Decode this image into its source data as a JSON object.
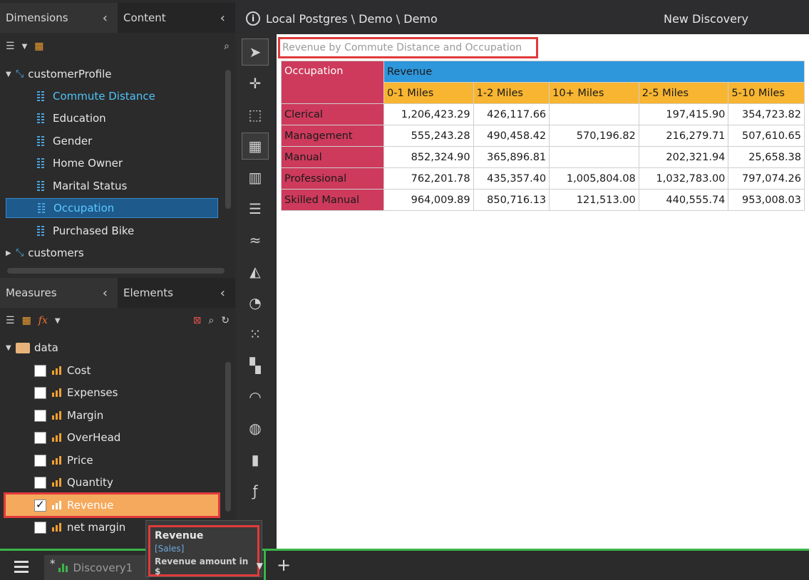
{
  "dimensions_panel": {
    "tab_dimensions": "Dimensions",
    "tab_content": "Content",
    "tree": [
      {
        "label": "customerProfile",
        "type": "hierarchy"
      },
      {
        "label": "Commute Distance",
        "type": "attribute",
        "state": "used"
      },
      {
        "label": "Education",
        "type": "attribute"
      },
      {
        "label": "Gender",
        "type": "attribute"
      },
      {
        "label": "Home Owner",
        "type": "attribute"
      },
      {
        "label": "Marital Status",
        "type": "attribute"
      },
      {
        "label": "Occupation",
        "type": "attribute",
        "state": "selected"
      },
      {
        "label": "Purchased Bike",
        "type": "attribute"
      },
      {
        "label": "customers",
        "type": "hierarchy"
      }
    ]
  },
  "measures_panel": {
    "tab_measures": "Measures",
    "tab_elements": "Elements",
    "folder": "data",
    "items": [
      {
        "label": "Cost",
        "checked": false
      },
      {
        "label": "Expenses",
        "checked": false
      },
      {
        "label": "Margin",
        "checked": false
      },
      {
        "label": "OverHead",
        "checked": false
      },
      {
        "label": "Price",
        "checked": false
      },
      {
        "label": "Quantity",
        "checked": false
      },
      {
        "label": "Revenue",
        "checked": true
      },
      {
        "label": "net margin",
        "checked": false
      }
    ]
  },
  "header": {
    "breadcrumb": "Local Postgres \\ Demo \\ Demo",
    "discovery": "New Discovery"
  },
  "visual": {
    "title": "Revenue by Commute Distance and Occupation",
    "row_header": "Occupation",
    "measure_header": "Revenue",
    "columns": [
      "0-1 Miles",
      "1-2 Miles",
      "10+ Miles",
      "2-5 Miles",
      "5-10 Miles"
    ],
    "rows": [
      {
        "label": "Clerical",
        "values": [
          "1,206,423.29",
          "426,117.66",
          "",
          "197,415.90",
          "354,723.82"
        ]
      },
      {
        "label": "Management",
        "values": [
          "555,243.28",
          "490,458.42",
          "570,196.82",
          "216,279.71",
          "507,610.65"
        ]
      },
      {
        "label": "Manual",
        "values": [
          "852,324.90",
          "365,896.81",
          "",
          "202,321.94",
          "25,658.38"
        ]
      },
      {
        "label": "Professional",
        "values": [
          "762,201.78",
          "435,357.40",
          "1,005,804.08",
          "1,032,783.00",
          "797,074.26"
        ]
      },
      {
        "label": "Skilled Manual",
        "values": [
          "964,009.89",
          "850,716.13",
          "121,513.00",
          "440,555.74",
          "953,008.03"
        ]
      }
    ]
  },
  "tooltip": {
    "title": "Revenue",
    "subtitle": "[Sales]",
    "description": "Revenue amount in $"
  },
  "bottom": {
    "tab_star": "*",
    "tab_label": "Discovery1",
    "add": "+"
  },
  "colors": {
    "occupation": "#cd3a5c",
    "measure": "#2e96db",
    "columns": "#f8b531",
    "highlight": "#e03a3a",
    "accent_green": "#3bb54a"
  }
}
